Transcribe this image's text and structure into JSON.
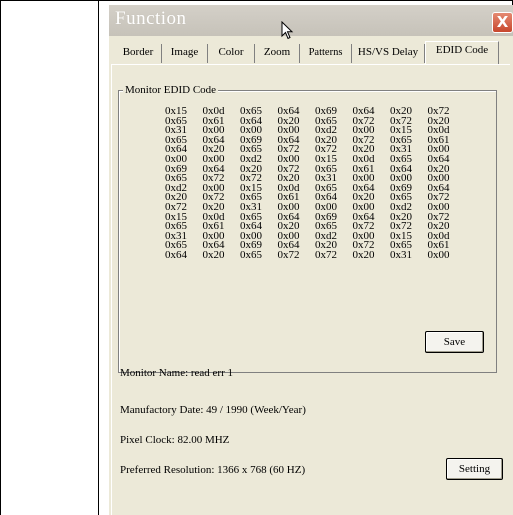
{
  "window": {
    "title": "Function",
    "close_label": "X"
  },
  "tabs": [
    "Border",
    "Image",
    "Color",
    "Zoom",
    "Patterns",
    "HS/VS Delay",
    "EDID Code"
  ],
  "active_tab": "EDID Code",
  "edid": {
    "group_label": "Monitor EDID Code",
    "rows": [
      [
        "0x15",
        "0x0d",
        "0x65",
        "0x64",
        "0x69",
        "0x64",
        "0x20",
        "0x72"
      ],
      [
        "0x65",
        "0x61",
        "0x64",
        "0x20",
        "0x65",
        "0x72",
        "0x72",
        "0x20"
      ],
      [
        "0x31",
        "0x00",
        "0x00",
        "0x00",
        "0xd2",
        "0x00",
        "0x15",
        "0x0d"
      ],
      [
        "0x65",
        "0x64",
        "0x69",
        "0x64",
        "0x20",
        "0x72",
        "0x65",
        "0x61"
      ],
      [
        "0x64",
        "0x20",
        "0x65",
        "0x72",
        "0x72",
        "0x20",
        "0x31",
        "0x00"
      ],
      [
        "0x00",
        "0x00",
        "0xd2",
        "0x00",
        "0x15",
        "0x0d",
        "0x65",
        "0x64"
      ],
      [
        "0x69",
        "0x64",
        "0x20",
        "0x72",
        "0x65",
        "0x61",
        "0x64",
        "0x20"
      ],
      [
        "0x65",
        "0x72",
        "0x72",
        "0x20",
        "0x31",
        "0x00",
        "0x00",
        "0x00"
      ],
      [
        "0xd2",
        "0x00",
        "0x15",
        "0x0d",
        "0x65",
        "0x64",
        "0x69",
        "0x64"
      ],
      [
        "0x20",
        "0x72",
        "0x65",
        "0x61",
        "0x64",
        "0x20",
        "0x65",
        "0x72"
      ],
      [
        "0x72",
        "0x20",
        "0x31",
        "0x00",
        "0x00",
        "0x00",
        "0xd2",
        "0x00"
      ],
      [
        "0x15",
        "0x0d",
        "0x65",
        "0x64",
        "0x69",
        "0x64",
        "0x20",
        "0x72"
      ],
      [
        "0x65",
        "0x61",
        "0x64",
        "0x20",
        "0x65",
        "0x72",
        "0x72",
        "0x20"
      ],
      [
        "0x31",
        "0x00",
        "0x00",
        "0x00",
        "0xd2",
        "0x00",
        "0x15",
        "0x0d"
      ],
      [
        "0x65",
        "0x64",
        "0x69",
        "0x64",
        "0x20",
        "0x72",
        "0x65",
        "0x61"
      ],
      [
        "0x64",
        "0x20",
        "0x65",
        "0x72",
        "0x72",
        "0x20",
        "0x31",
        "0x00"
      ]
    ],
    "save_label": "Save"
  },
  "info": {
    "monitor_name": "Monitor Name: read err 1",
    "manufactory_date": "Manufactory Date: 49 / 1990 (Week/Year)",
    "pixel_clock": "Pixel Clock: 82.00 MHZ",
    "preferred_resolution": "Preferred Resolution: 1366 x 768 (60 HZ)"
  },
  "setting_label": "Setting"
}
